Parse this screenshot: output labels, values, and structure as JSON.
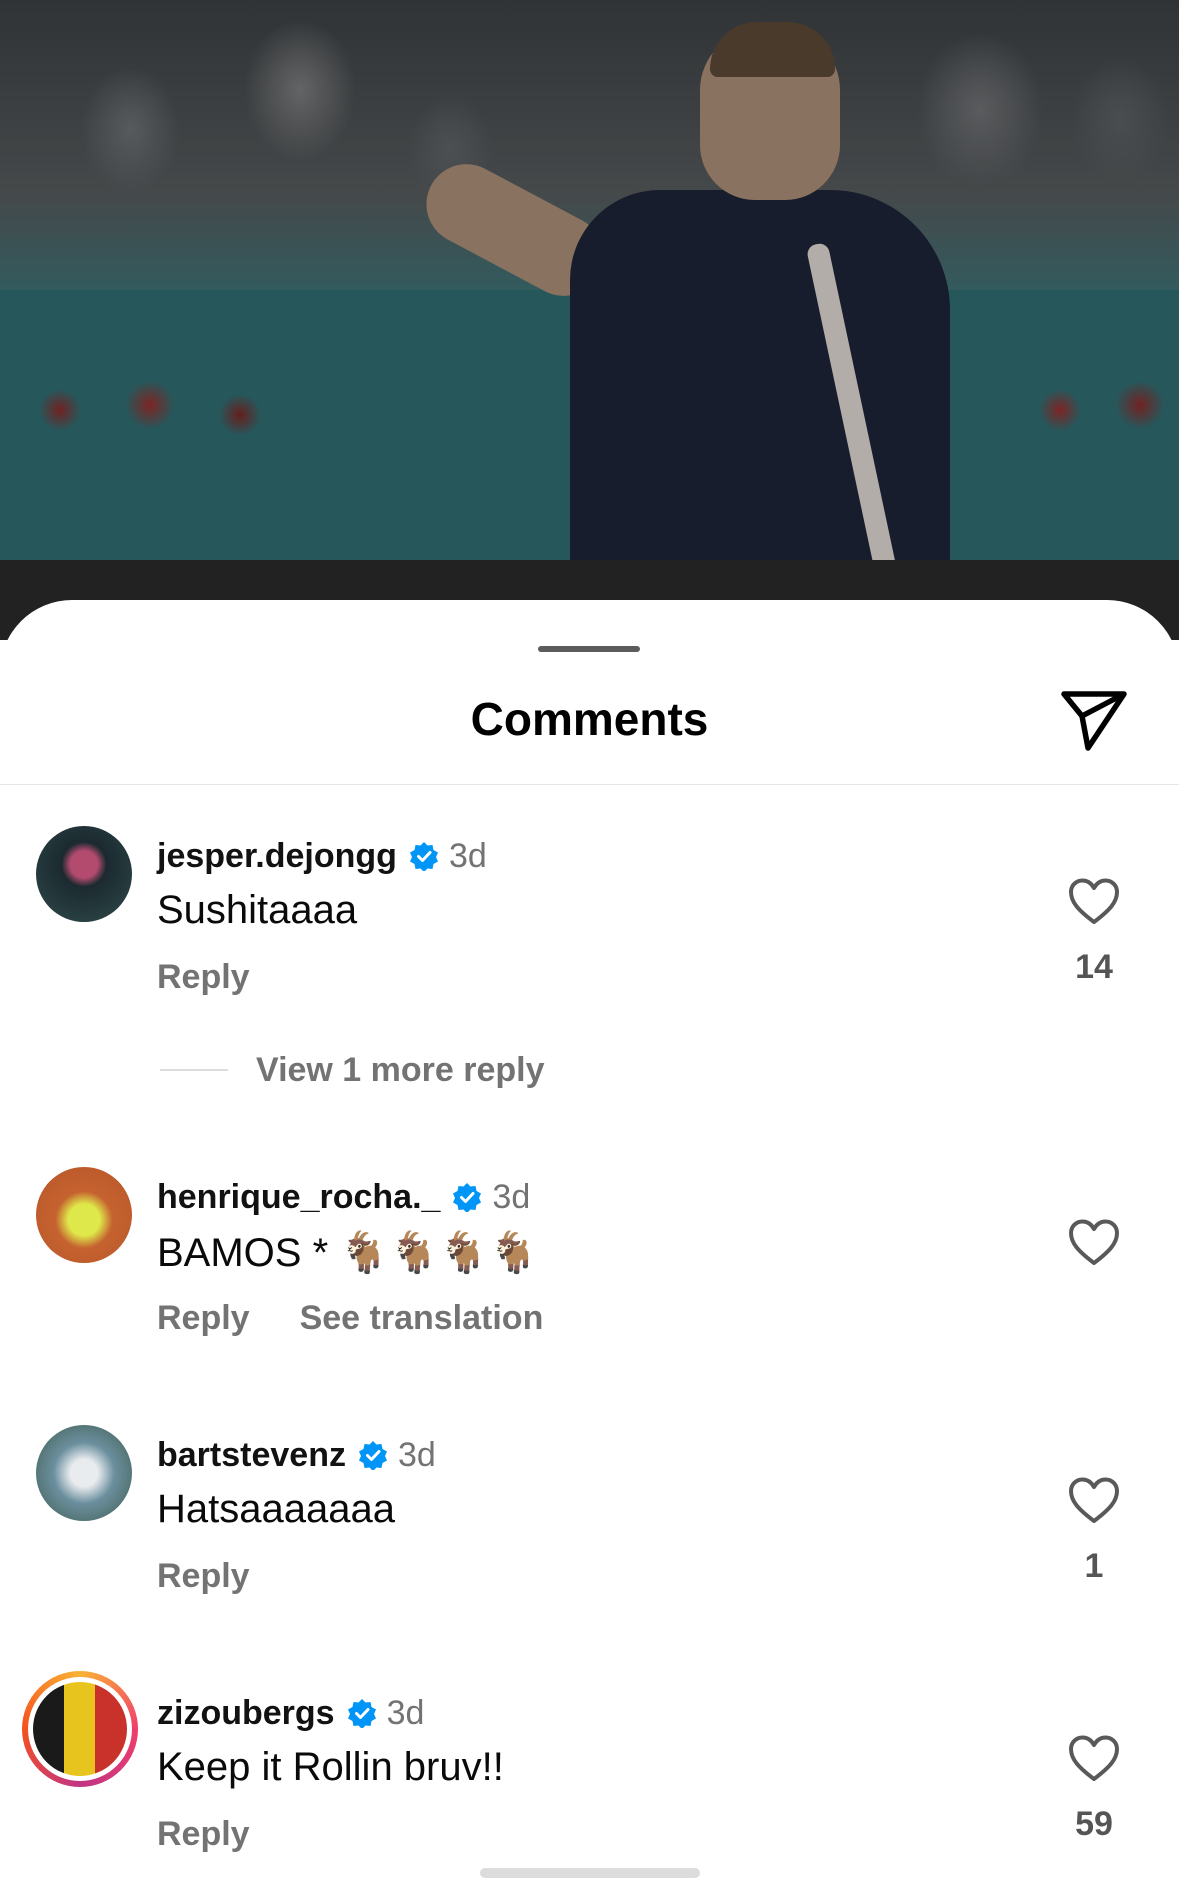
{
  "sheet": {
    "title": "Comments"
  },
  "comments": [
    {
      "username": "jesper.dejongg",
      "time": "3d",
      "text": "Sushitaaaa",
      "reply_label": "Reply",
      "likes": "14",
      "view_replies": "View 1 more reply"
    },
    {
      "username": "henrique_rocha._",
      "time": "3d",
      "text": "BAMOS * 🐐🐐🐐🐐",
      "reply_label": "Reply",
      "translate_label": "See translation",
      "likes": ""
    },
    {
      "username": "bartstevenz",
      "time": "3d",
      "text": "Hatsaaaaaaa",
      "reply_label": "Reply",
      "likes": "1"
    },
    {
      "username": "zizoubergs",
      "time": "3d",
      "text": "Keep it Rollin bruv!!",
      "reply_label": "Reply",
      "likes": "59"
    }
  ],
  "colors": {
    "verified": "#0095f6",
    "secondary_text": "#737373",
    "story_ring": "#f03e6c"
  },
  "icons": {
    "share": "paper-plane-icon",
    "like": "heart-outline-icon",
    "verified": "verified-badge-icon"
  }
}
